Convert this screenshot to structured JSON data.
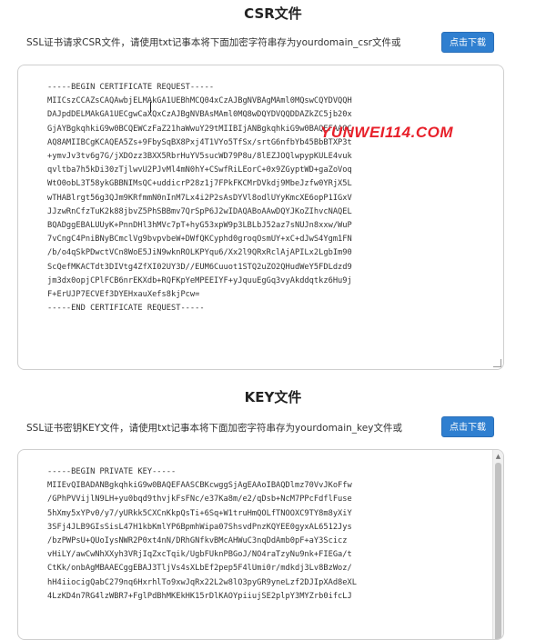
{
  "csr": {
    "title": "CSR文件",
    "description": "SSL证书请求CSR文件，请使用txt记事本将下面加密字符串存为yourdomain_csr文件或",
    "button_label": "点击下载",
    "content": "-----BEGIN CERTIFICATE REQUEST-----\nMIICszCCAZsCAQAwbjELMAkGA1UEBhMCQ04xCzAJBgNVBAgMAml0MQswCQYDVQQH\nDAJpdDELMAkGA1UECgwCaXQxCzAJBgNVBAsMAml0MQ8wDQYDVQQDDAZkZC5jb20x\nGjAYBgkqhkiG9w0BCQEWCzFaZ21haWwuY29tMIIBIjANBgkqhkiG9w0BAQEFAAOC\nAQ8AMIIBCgKCAQEA5Zs+9FbySqBX8Pxj4T1VYo5TfSx/srtG6nfbYb45BbBTXP3t\n+ymvJv3tv6g7G/jXDOzz3BXX5RbrHuYV5sucWD79P8u/8lEZJOQlwpypKULE4vuk\nqvltba7h5kDi30zTjlwvU2PJvMl4mN0hY+CSwfRiLEorC+0x9ZGyptWD+gaZoVoq\nWtO0obL3T58ykGBBNIMsQC+uddicrP28z1j7FPkFKCMrDVkdj9MbeJzfw0YRjX5L\nwTHABlrgt56g3QJm9KRfmmN0nInM7Lx4i2P2sAsDYVl8odlUYyKmcXE6opP1IGxV\nJJzwRnCfzTuK2k88jbvZ5PhSBBmv7QrSpP6J2wIDAQABoAAwDQYJKoZIhvcNAQEL\nBQADggEBALUUyK+PnnDHl3hMVc7pT+hyG53xpW9p3LBLbJ52az7sNUJn8xxw/WuP\n7vCngC4PniBNyBCmclVg9bvpvbeW+DWfQKCyphd0groqOsmUY+xC+dJwS4Ygm1FN\n/b/o4qSkPDwctVCn8WoE5JiN9wknROLKPYqu6/Xx2l9QRxRclAjAPILx2LgbIm90\nScQefMKACTdt3DIVtg4ZfXI02UY3D//EUM6Cuuot1STQ2uZO2QHudWeY5FDLdzd9\njm3dx0opjCPlFCB6nrEKXdb+RQFKpYeMPEEIYF+yJquuEgGq3vyAkddqtkz6Hu9j\nF+ErUJP7ECVEf3DYEHxauXefs8kjPcw=\n-----END CERTIFICATE REQUEST-----"
  },
  "key": {
    "title": "KEY文件",
    "description": "SSL证书密钥KEY文件，请使用txt记事本将下面加密字符串存为yourdomain_key文件或",
    "button_label": "点击下载",
    "content": "-----BEGIN PRIVATE KEY-----\nMIIEvQIBADANBgkqhkiG9w0BAQEFAASCBKcwggSjAgEAAoIBAQDlmz70VvJKoFfw\n/GPhPVVijlN9LH+yu0bqd9thvjkFsFNc/e37Ka8m/e2/qDsb+NcM7PPcFdflFuse\n5hXmy5xYPv0/y7/yURkk5CXCnKkpQsTi+6Sq+W1truHmQOLfTNOOXC9TY8m8yXiY\n3SFj4JLB9GIsSisL47H1kbKmlYP6BpmhWipa07ShsvdPnzKQYEE0gyxAL6512Jys\n/bzPWPsU+QUoIysNWR2P0xt4nN/DRhGNfkvBMcAHWuC3nqDdAmb0pF+aY3Scicz\nvHiLY/awCwNhXXyh3VRjIqZxcTqik/UgbFUknPBGoJ/NO4raTzyNu9nk+FIEGa/t\nCtKk/onbAgMBAAECggEBAJ3TljVs4sXLbEf2pep5F4lUmi0r/mdkdj3Lv8BzWoz/\nhH4iiocigQabC279nq6HxrhlTo9xwJqRx22L2w8lO3pyGR9yneLzf2DJIpXAd8eXL\n4LzKD4n7RG4lzWBR7+FglPdBhMKEkHK15rDlKAOYpiiujSE2plpY3MYZrb0ifcLJ"
  },
  "watermark": "YUNWEI114.COM",
  "colors": {
    "button": "#2f7fd0",
    "watermark": "#e8202a"
  },
  "icons": {
    "resize": "resize-grip-icon",
    "scroll_up": "scroll-up-arrow-icon"
  }
}
